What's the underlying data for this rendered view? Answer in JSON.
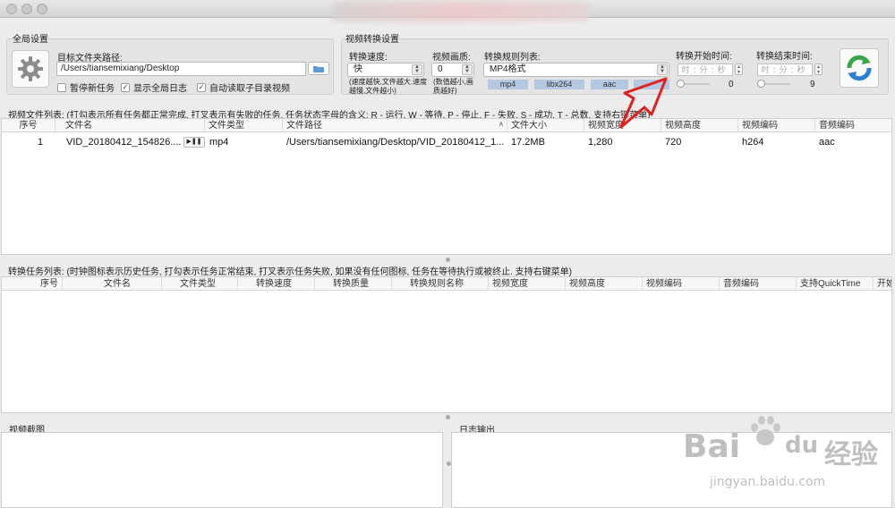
{
  "global": {
    "group_title": "全局设置",
    "target_folder_label": "目标文件夹路径:",
    "target_folder_value": "/Users/tiansemixiang/Desktop",
    "checkboxes": [
      {
        "label": "暂停新任务",
        "checked": false
      },
      {
        "label": "显示全局日志",
        "checked": true
      },
      {
        "label": "自动读取子目录视频",
        "checked": true
      }
    ]
  },
  "convert": {
    "group_title": "视频转换设置",
    "speed_label": "转换速度:",
    "speed_value": "快",
    "speed_hint": "(速度越快,文件越大.速度越慢,文件越小)",
    "quality_label": "视频画质:",
    "quality_value": "0",
    "quality_hint": "(数值越小,画质越好)",
    "rule_label": "转换规则列表:",
    "rule_value": "MP4格式",
    "rule_tags": [
      "mp4",
      "libx264",
      "aac"
    ],
    "start_time_label": "转换开始时间:",
    "end_time_label": "转换结束时间:",
    "time_placeholders": [
      "时",
      "分",
      "秒"
    ],
    "start_slider_value": "0",
    "end_slider_value": "9"
  },
  "file_list": {
    "caption": "视频文件列表: (打勾表示所有任务都正常完成, 打叉表示有失败的任务. 任务状态字母的含义: R - 运行, W - 等待, P - 停止, F - 失败, S - 成功, T - 总数. 支持右键菜单)",
    "columns": [
      "序号",
      "文件名",
      "文件类型",
      "文件路径",
      "文件大小",
      "视频宽度",
      "视频高度",
      "视频编码",
      "音频编码"
    ],
    "rows": [
      {
        "index": "1",
        "name": "VID_20180412_154826....",
        "type": "mp4",
        "path": "/Users/tiansemixiang/Desktop/VID_20180412_1...",
        "size": "17.2MB",
        "width": "1,280",
        "height": "720",
        "vcodec": "h264",
        "acodec": "aac"
      }
    ]
  },
  "task_list": {
    "caption": "转换任务列表: (时钟图标表示历史任务, 打勾表示任务正常结束, 打叉表示任务失败, 如果没有任何图标, 任务在等待执行或被终止. 支持右键菜单)",
    "columns": [
      "序号",
      "文件名",
      "文件类型",
      "转换速度",
      "转换质量",
      "转换规则名称",
      "视频宽度",
      "视频高度",
      "视频编码",
      "音频编码",
      "支持QuickTime",
      "开始时"
    ]
  },
  "bottom": {
    "screenshot_title": "视频截图",
    "log_title": "日志输出"
  },
  "watermark": {
    "brand": "Bai",
    "brand2": "du",
    "cn": "经验",
    "url": "jingyan.baidu.com"
  },
  "colors": {
    "tag_bg": "#b5c8e2",
    "arrow": "#e02020",
    "refresh_green": "#3aa64a",
    "refresh_blue": "#2f7fd0"
  }
}
